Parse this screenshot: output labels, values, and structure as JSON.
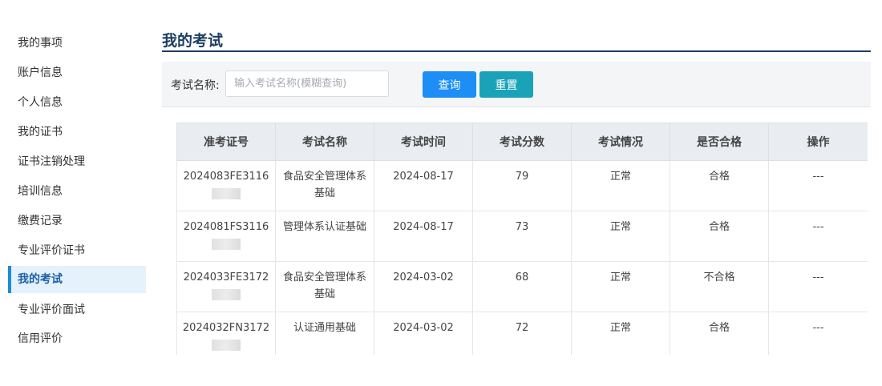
{
  "sidebar": {
    "items": [
      {
        "label": "我的事项"
      },
      {
        "label": "账户信息"
      },
      {
        "label": "个人信息"
      },
      {
        "label": "我的证书"
      },
      {
        "label": "证书注销处理"
      },
      {
        "label": "培训信息"
      },
      {
        "label": "缴费记录"
      },
      {
        "label": "专业评价证书"
      },
      {
        "label": "我的考试",
        "active": true
      },
      {
        "label": "专业评价面试"
      },
      {
        "label": "信用评价"
      }
    ]
  },
  "page": {
    "title": "我的考试"
  },
  "search": {
    "label": "考试名称:",
    "placeholder": "输入考试名称(模糊查询)",
    "query_label": "查询",
    "reset_label": "重置"
  },
  "table": {
    "headers": [
      "准考证号",
      "考试名称",
      "考试时间",
      "考试分数",
      "考试情况",
      "是否合格",
      "操作"
    ],
    "rows": [
      {
        "ticket": "2024083FE3116",
        "exam": "食品安全管理体系基础",
        "date": "2024-08-17",
        "score": "79",
        "status": "正常",
        "pass": "合格",
        "action": "---"
      },
      {
        "ticket": "2024081FS3116",
        "exam": "管理体系认证基础",
        "date": "2024-08-17",
        "score": "73",
        "status": "正常",
        "pass": "合格",
        "action": "---"
      },
      {
        "ticket": "2024033FE3172",
        "exam": "食品安全管理体系基础",
        "date": "2024-03-02",
        "score": "68",
        "status": "正常",
        "pass": "不合格",
        "action": "---"
      },
      {
        "ticket": "2024032FN3172",
        "exam": "认证通用基础",
        "date": "2024-03-02",
        "score": "72",
        "status": "正常",
        "pass": "合格",
        "action": "---"
      }
    ]
  }
}
